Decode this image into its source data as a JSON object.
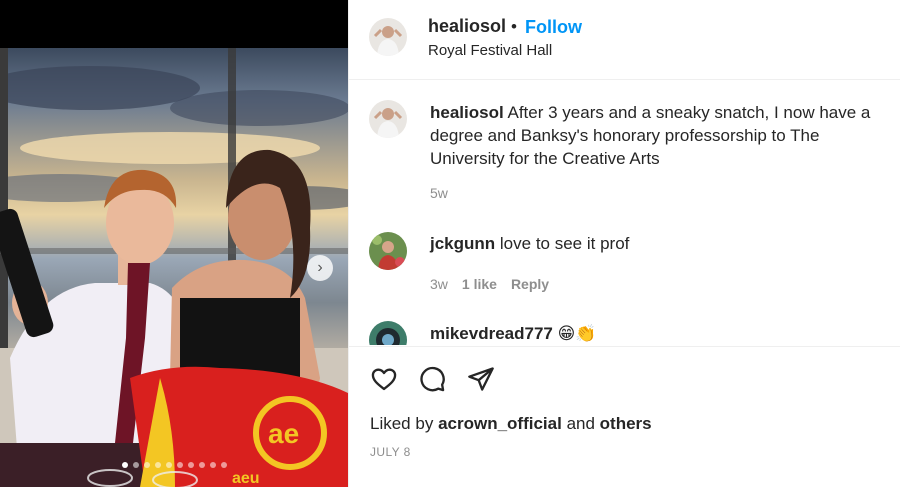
{
  "post": {
    "username": "healiosol",
    "separator": "•",
    "follow_label": "Follow",
    "location": "Royal Festival Hall",
    "caption_user": "healiosol",
    "caption_text": "After 3 years and a sneaky snatch, I now have a degree and Banksy's honorary professorship to The University for the Creative Arts",
    "caption_time": "5w",
    "photo": {
      "carousel_total": 10,
      "carousel_active": 1,
      "bag_text": "aeu"
    }
  },
  "comments": [
    {
      "user": "jckgunn",
      "text": "love to see it prof",
      "time": "3w",
      "likes": "1 like",
      "reply": "Reply"
    },
    {
      "user": "mikevdread777",
      "text": "😁👏"
    }
  ],
  "actions": {
    "liked_prefix": "Liked by",
    "liked_user": "acrown_official",
    "liked_and": "and",
    "liked_others": "others",
    "date": "JULY 8",
    "icons": [
      "heart-icon",
      "comment-icon",
      "share-icon"
    ]
  },
  "colors": {
    "link": "#0095f6",
    "text": "#262626",
    "muted": "#8e8e8e",
    "divider": "#efefef"
  }
}
